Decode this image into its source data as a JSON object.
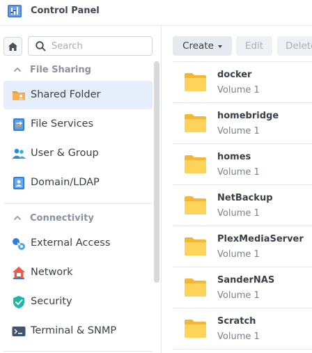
{
  "window": {
    "title": "Control Panel"
  },
  "search": {
    "placeholder": "Search"
  },
  "sidebar": {
    "sections": [
      {
        "label": "File Sharing"
      },
      {
        "label": "Connectivity"
      }
    ],
    "items": [
      {
        "label": "Shared Folder",
        "icon": "shared-folder-icon",
        "active": true
      },
      {
        "label": "File Services",
        "icon": "file-services-icon"
      },
      {
        "label": "User & Group",
        "icon": "user-group-icon"
      },
      {
        "label": "Domain/LDAP",
        "icon": "domain-ldap-icon"
      },
      {
        "label": "External Access",
        "icon": "external-access-icon"
      },
      {
        "label": "Network",
        "icon": "network-icon"
      },
      {
        "label": "Security",
        "icon": "security-icon"
      },
      {
        "label": "Terminal & SNMP",
        "icon": "terminal-icon"
      }
    ]
  },
  "toolbar": {
    "create_label": "Create",
    "edit_label": "Edit",
    "delete_label": "Delete"
  },
  "folders": [
    {
      "name": "docker",
      "volume": "Volume 1"
    },
    {
      "name": "homebridge",
      "volume": "Volume 1"
    },
    {
      "name": "homes",
      "volume": "Volume 1"
    },
    {
      "name": "NetBackup",
      "volume": "Volume 1"
    },
    {
      "name": "PlexMediaServer",
      "volume": "Volume 1"
    },
    {
      "name": "SanderNAS",
      "volume": "Volume 1"
    },
    {
      "name": "Scratch",
      "volume": "Volume 1"
    }
  ],
  "colors": {
    "accent": "#3a8ee6",
    "active_bg": "#e5eefa",
    "folder": "#f7c948"
  }
}
